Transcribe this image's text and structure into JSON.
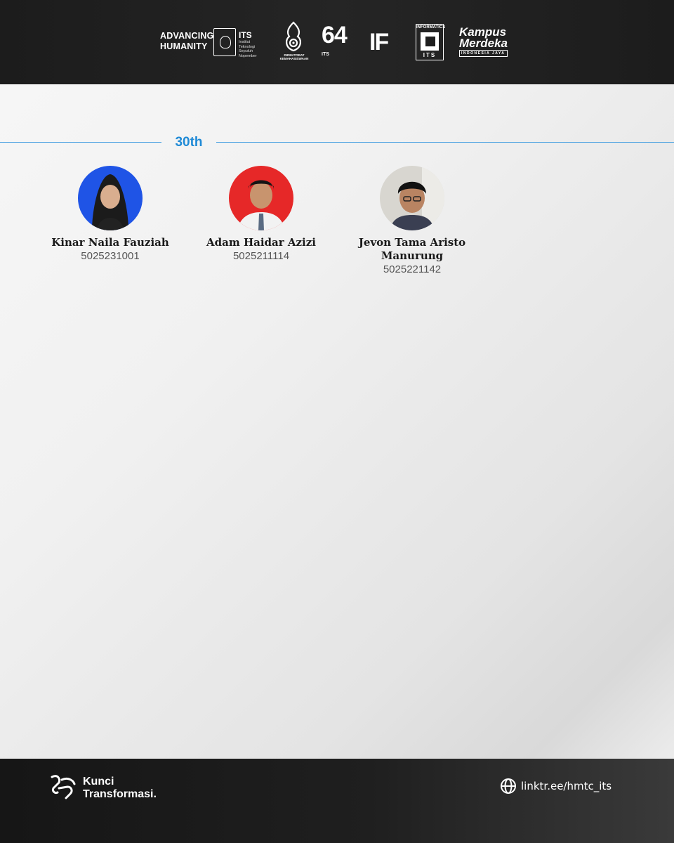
{
  "header": {
    "advancing_line1": "ADVANCING",
    "advancing_line2": "HUMANITY",
    "its_name": "ITS",
    "its_sub": "Institut Teknologi Sepuluh Nopember",
    "direktorat": "DIREKTORAT KEMAHASISWAAN",
    "anniv_number": "64",
    "anniv_sub": "ITS",
    "if_logo": "IF",
    "informatics_top": "INFORMATICS",
    "informatics_bottom": "ITS",
    "kampus_merdeka_line1": "Kampus",
    "kampus_merdeka_line2": "Merdeka",
    "kampus_merdeka_sub": "INDONESIA JAYA"
  },
  "section": {
    "label": "30th"
  },
  "members": [
    {
      "name": "Kinar Naila Fauziah",
      "nrp": "5025231001",
      "photo_bg": "#1f54e6"
    },
    {
      "name": "Adam Haidar Azizi",
      "nrp": "5025211114",
      "photo_bg": "#e62828"
    },
    {
      "name": "Jevon Tama Aristo Manurung",
      "nrp": "5025221142",
      "photo_bg": "#d8d6d0"
    }
  ],
  "footer": {
    "tagline_line1": "Kunci",
    "tagline_line2": "Transformasi.",
    "link": "linktr.ee/hmtc_its",
    "link_icon": "globe-icon"
  }
}
